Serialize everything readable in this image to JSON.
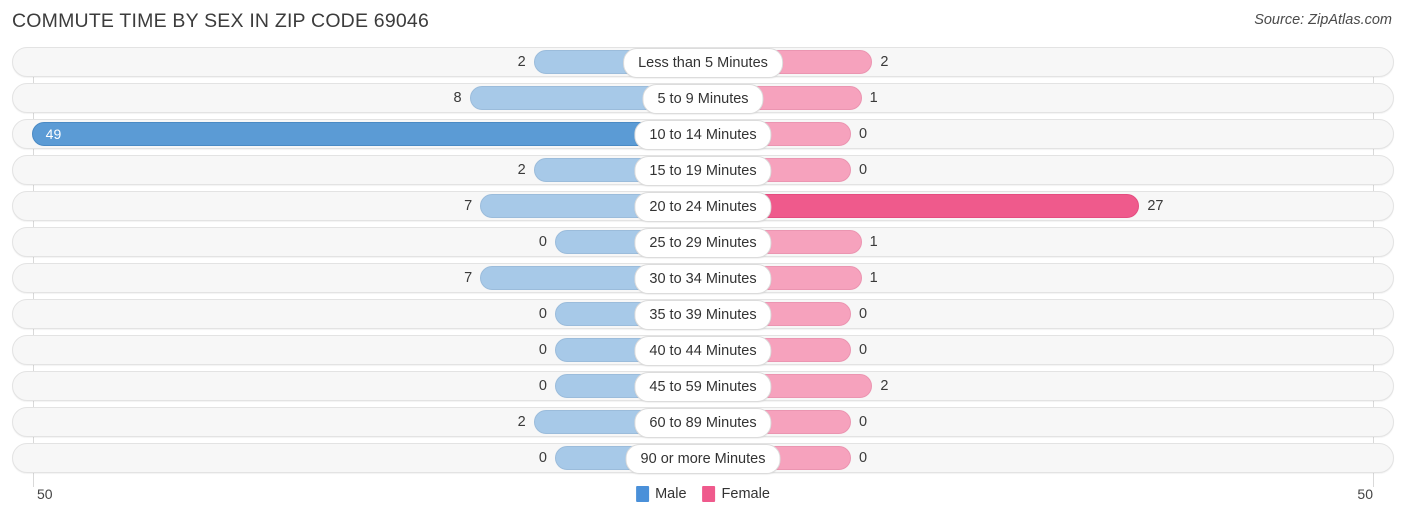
{
  "header": {
    "title": "COMMUTE TIME BY SEX IN ZIP CODE 69046",
    "source": "Source: ZipAtlas.com"
  },
  "footer": {
    "axis_left": "50",
    "axis_right": "50",
    "legend": [
      {
        "label": "Male",
        "color": "#4a90d9",
        "icon": "legend-swatch-male"
      },
      {
        "label": "Female",
        "color": "#ef5a8c",
        "icon": "legend-swatch-female"
      }
    ]
  },
  "chart_data": {
    "type": "bar",
    "orientation": "horizontal-diverging",
    "title": "COMMUTE TIME BY SEX IN ZIP CODE 69046",
    "xlabel": "",
    "ylabel": "",
    "xlim": [
      50,
      50
    ],
    "axis_max": 50,
    "grid": true,
    "legend_position": "bottom-center",
    "categories": [
      "Less than 5 Minutes",
      "5 to 9 Minutes",
      "10 to 14 Minutes",
      "15 to 19 Minutes",
      "20 to 24 Minutes",
      "25 to 29 Minutes",
      "30 to 34 Minutes",
      "35 to 39 Minutes",
      "40 to 44 Minutes",
      "45 to 59 Minutes",
      "60 to 89 Minutes",
      "90 or more Minutes"
    ],
    "series": [
      {
        "name": "Male",
        "color": "#a7c9e8",
        "peak_color": "#5b9bd5",
        "values": [
          2,
          8,
          49,
          2,
          7,
          0,
          7,
          0,
          0,
          0,
          2,
          0
        ]
      },
      {
        "name": "Female",
        "color": "#f6a2bd",
        "peak_color": "#ef5a8c",
        "values": [
          2,
          1,
          0,
          0,
          27,
          1,
          1,
          0,
          0,
          2,
          0,
          0
        ]
      }
    ],
    "rows": [
      {
        "category": "Less than 5 Minutes",
        "male": 2,
        "female": 2,
        "male_label": "2",
        "female_label": "2"
      },
      {
        "category": "5 to 9 Minutes",
        "male": 8,
        "female": 1,
        "male_label": "8",
        "female_label": "1"
      },
      {
        "category": "10 to 14 Minutes",
        "male": 49,
        "female": 0,
        "male_label": "49",
        "female_label": "0"
      },
      {
        "category": "15 to 19 Minutes",
        "male": 2,
        "female": 0,
        "male_label": "2",
        "female_label": "0"
      },
      {
        "category": "20 to 24 Minutes",
        "male": 7,
        "female": 27,
        "male_label": "7",
        "female_label": "27"
      },
      {
        "category": "25 to 29 Minutes",
        "male": 0,
        "female": 1,
        "male_label": "0",
        "female_label": "1"
      },
      {
        "category": "30 to 34 Minutes",
        "male": 7,
        "female": 1,
        "male_label": "7",
        "female_label": "1"
      },
      {
        "category": "35 to 39 Minutes",
        "male": 0,
        "female": 0,
        "male_label": "0",
        "female_label": "0"
      },
      {
        "category": "40 to 44 Minutes",
        "male": 0,
        "female": 0,
        "male_label": "0",
        "female_label": "0"
      },
      {
        "category": "45 to 59 Minutes",
        "male": 0,
        "female": 2,
        "male_label": "0",
        "female_label": "2"
      },
      {
        "category": "60 to 89 Minutes",
        "male": 2,
        "female": 0,
        "male_label": "2",
        "female_label": "0"
      },
      {
        "category": "90 or more Minutes",
        "male": 0,
        "female": 0,
        "male_label": "0",
        "female_label": "0"
      }
    ]
  }
}
